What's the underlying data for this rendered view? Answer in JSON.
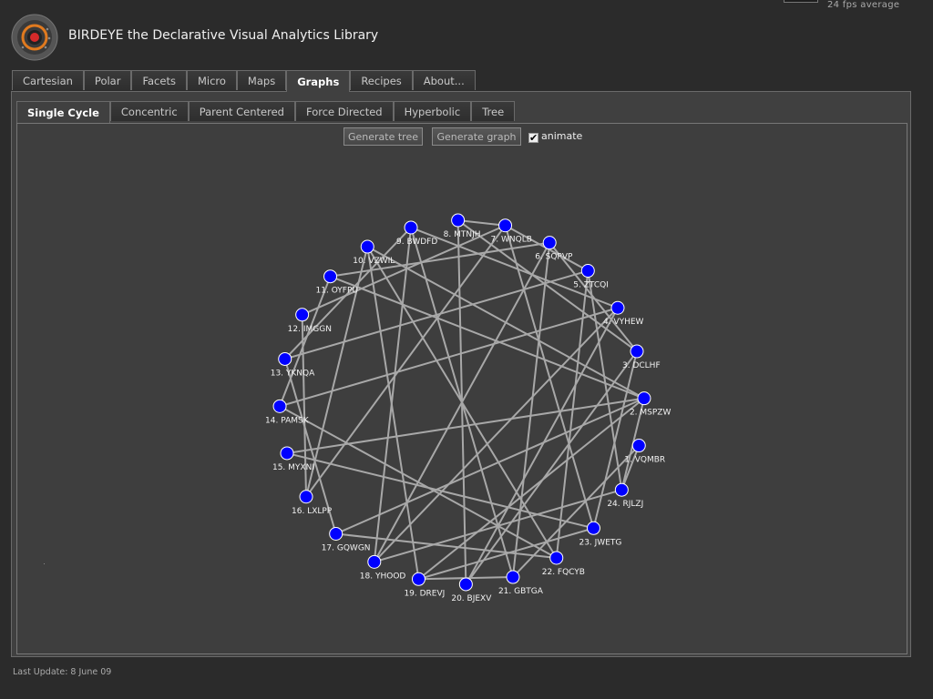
{
  "header": {
    "title": "BIRDEYE the Declarative Visual Analytics Library",
    "fps": "24 fps average"
  },
  "main_tabs": [
    {
      "label": "Cartesian",
      "active": false
    },
    {
      "label": "Polar",
      "active": false
    },
    {
      "label": "Facets",
      "active": false
    },
    {
      "label": "Micro",
      "active": false
    },
    {
      "label": "Maps",
      "active": false
    },
    {
      "label": "Graphs",
      "active": true
    },
    {
      "label": "Recipes",
      "active": false
    },
    {
      "label": "About...",
      "active": false
    }
  ],
  "sub_tabs": [
    {
      "label": "Single Cycle",
      "active": true
    },
    {
      "label": "Concentric",
      "active": false
    },
    {
      "label": "Parent Centered",
      "active": false
    },
    {
      "label": "Force Directed",
      "active": false
    },
    {
      "label": "Hyperbolic",
      "active": false
    },
    {
      "label": "Tree",
      "active": false
    }
  ],
  "toolbar": {
    "generate_tree": "Generate tree",
    "generate_graph": "Generate graph",
    "animate_label": "animate",
    "animate_checked": true
  },
  "graph": {
    "layout": "single-cycle",
    "node_color": "#0000ff",
    "edge_color": "#a8a8a8",
    "nodes": [
      "1. VQMBR",
      "2. MSPZW",
      "3. DCLHF",
      "4. VYHEW",
      "5. ZTCQI",
      "6. SQPVP",
      "7. WNQLB",
      "8. MTNJH",
      "9. BWDFD",
      "10. VZWIL",
      "11. OYFPU",
      "12. IMGGN",
      "13. YKNQA",
      "14. PAMSK",
      "15. MYXNI",
      "16. LXLPP",
      "17. GQWGN",
      "18. YHOOD",
      "19. DREVJ",
      "20. BJEXV",
      "21. GBTGA",
      "22. FQCYB",
      "23. JWETG",
      "24. RJLZJ"
    ],
    "edges": [
      [
        1,
        24
      ],
      [
        2,
        24
      ],
      [
        2,
        15
      ],
      [
        2,
        11
      ],
      [
        2,
        10
      ],
      [
        2,
        17
      ],
      [
        2,
        19
      ],
      [
        3,
        23
      ],
      [
        3,
        20
      ],
      [
        4,
        9
      ],
      [
        4,
        18
      ],
      [
        4,
        14
      ],
      [
        5,
        13
      ],
      [
        5,
        22
      ],
      [
        5,
        24
      ],
      [
        6,
        21
      ],
      [
        6,
        11
      ],
      [
        7,
        8
      ],
      [
        7,
        5
      ],
      [
        7,
        23
      ],
      [
        7,
        16
      ],
      [
        8,
        3
      ],
      [
        8,
        20
      ],
      [
        9,
        13
      ],
      [
        9,
        21
      ],
      [
        9,
        18
      ],
      [
        10,
        16
      ],
      [
        10,
        19
      ],
      [
        11,
        14
      ],
      [
        12,
        16
      ],
      [
        12,
        7
      ],
      [
        13,
        17
      ],
      [
        14,
        22
      ],
      [
        15,
        23
      ],
      [
        17,
        22
      ],
      [
        18,
        6
      ],
      [
        19,
        21
      ],
      [
        21,
        1
      ],
      [
        22,
        10
      ],
      [
        23,
        19
      ],
      [
        20,
        4
      ],
      [
        24,
        18
      ],
      [
        6,
        3
      ]
    ]
  },
  "footer": {
    "last_update": "Last Update: 8 June 09"
  }
}
